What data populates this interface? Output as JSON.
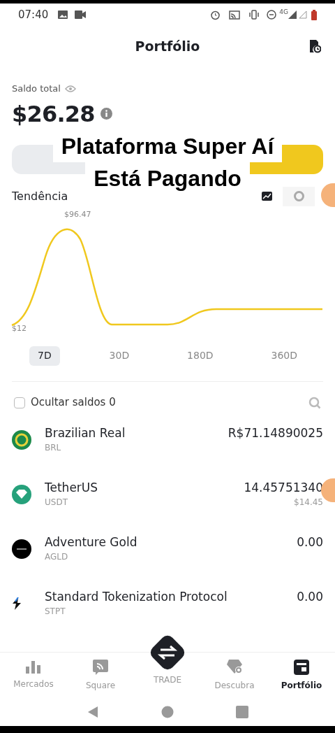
{
  "status_bar": {
    "time": "07:40",
    "network": "4G"
  },
  "header": {
    "title": "Portfólio"
  },
  "balance": {
    "label": "Saldo total",
    "amount": "$26.28"
  },
  "caption": [
    "Plataforma Super Aí",
    "Está Pagando"
  ],
  "trend": {
    "title": "Tendência",
    "chart_toggle": [
      {
        "selected": true
      },
      {
        "selected": false
      }
    ],
    "max_label": "$96.47",
    "min_label": "$12"
  },
  "periods": [
    {
      "label": "7D",
      "selected": true
    },
    {
      "label": "30D",
      "selected": false
    },
    {
      "label": "180D",
      "selected": false
    },
    {
      "label": "360D",
      "selected": false
    }
  ],
  "hide_balances": {
    "label": "Ocultar saldos 0",
    "checked": false
  },
  "assets": [
    {
      "name": "Brazilian Real",
      "symbol": "BRL",
      "amount": "R$71.14890025"
    },
    {
      "name": "TetherUS",
      "symbol": "USDT",
      "amount": "14.45751340",
      "value": "$14.45"
    },
    {
      "name": "Adventure Gold",
      "symbol": "AGLD",
      "amount": "0.00"
    },
    {
      "name": "Standard Tokenization Protocol",
      "symbol": "STPT",
      "amount": "0.00"
    }
  ],
  "nav": [
    {
      "label": "Mercados",
      "kind": "tab",
      "selected": false
    },
    {
      "label": "Square",
      "kind": "tab",
      "selected": false
    },
    {
      "label": "TRADE",
      "kind": "center",
      "selected": false
    },
    {
      "label": "Descubra",
      "kind": "tab",
      "selected": false
    },
    {
      "label": "Portfólio",
      "kind": "tab",
      "selected": true
    }
  ]
}
